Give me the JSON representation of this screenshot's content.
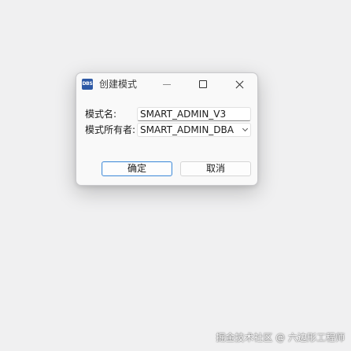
{
  "dialog": {
    "title": "创建模式",
    "app_icon_text": "DBS",
    "icons": {
      "minimize": "minimize-icon",
      "maximize": "maximize-icon",
      "close": "close-icon"
    },
    "form": {
      "schema_name_label": "模式名:",
      "schema_name_value": "SMART_ADMIN_V3",
      "owner_label": "模式所有者:",
      "owner_value": "SMART_ADMIN_DBA"
    },
    "buttons": {
      "ok": "确定",
      "cancel": "取消"
    }
  },
  "watermark": "掘金技术社区 @ 六边形工程师",
  "colors": {
    "accent": "#4a90d9",
    "app_icon": "#2d59a5",
    "background": "#f0f0f1"
  }
}
